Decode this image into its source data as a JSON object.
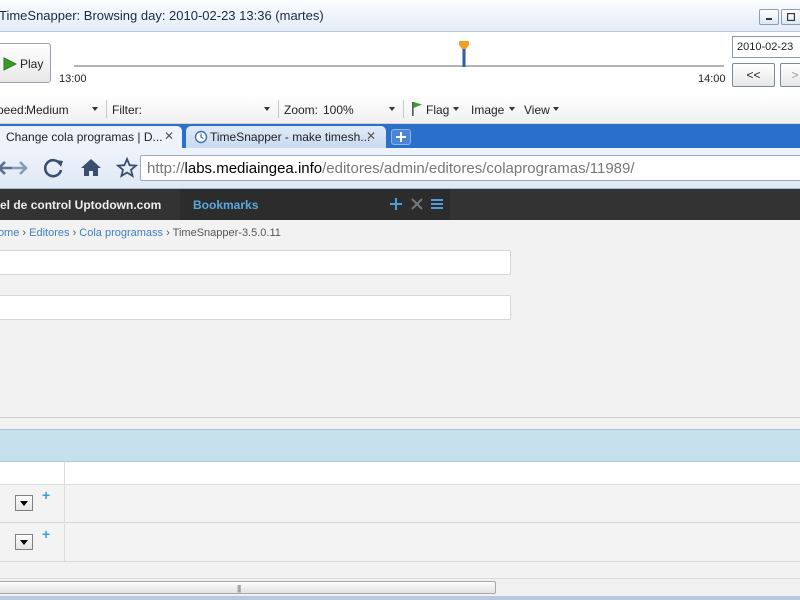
{
  "window": {
    "title": "TimeSnapper: Browsing day: 2010-02-23 13:36 (martes)"
  },
  "timeline": {
    "play_label": "Play",
    "start_time": "13:00",
    "end_time": "14:00",
    "date_value": "2010-02-23",
    "prev_label": "<<",
    "next_label": ">",
    "position": 0.6
  },
  "options": {
    "speed_label": "Speed:",
    "speed_value": "Medium",
    "filter_label": "Filter:",
    "filter_value": "",
    "zoom_label": "Zoom:",
    "zoom_value": "100%",
    "flag_label": "Flag",
    "image_label": "Image",
    "view_label": "View"
  },
  "browser": {
    "tabs": [
      {
        "label": "Change cola programas | D..."
      },
      {
        "label": "TimeSnapper - make timesh..."
      }
    ],
    "url": {
      "scheme": "http://",
      "host": "labs.mediaingea.info",
      "path": "/editores/admin/editores/colaprogramas/11989/"
    }
  },
  "site_toolbar": {
    "site_name": "Panel de control Uptodown.com",
    "bookmarks_label": "Bookmarks"
  },
  "breadcrumb": {
    "items": [
      "Home",
      "Editores",
      "Cola programass"
    ],
    "current": "TimeSnapper-3.5.0.11",
    "separator": "›"
  },
  "colors": {
    "tabstrip": "#2a6fc9",
    "dark_toolbar": "#333333",
    "link": "#3f7fbf",
    "table_header": "#c6e1ec"
  }
}
